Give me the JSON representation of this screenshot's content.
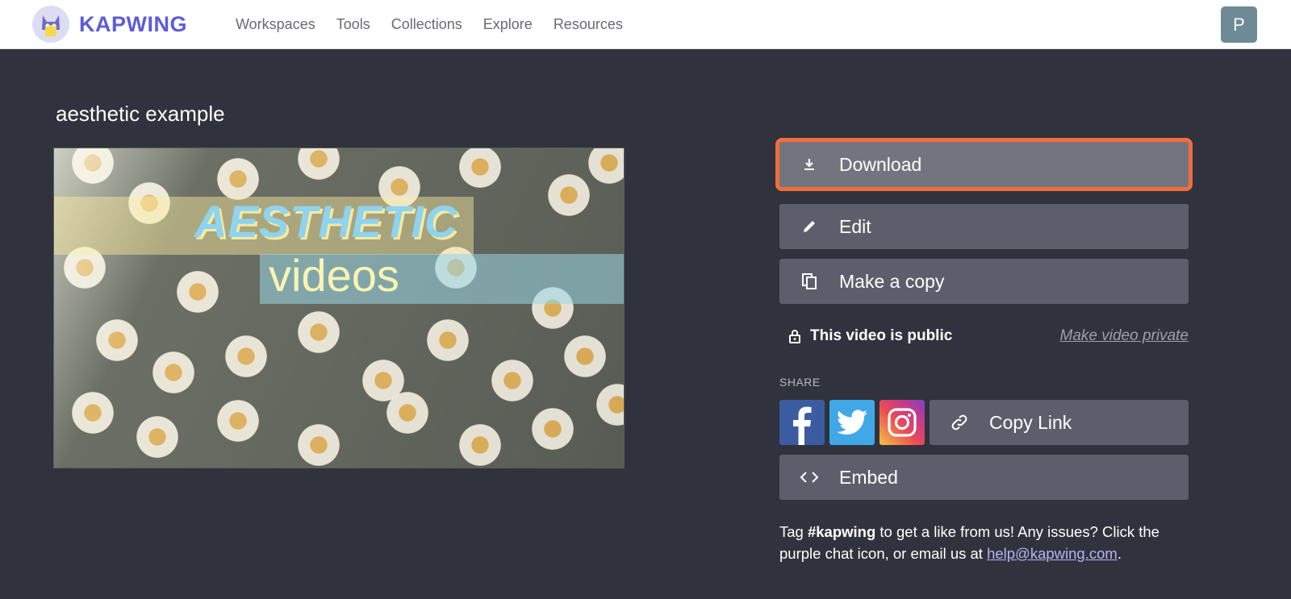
{
  "header": {
    "brand": "KAPWING",
    "nav": [
      "Workspaces",
      "Tools",
      "Collections",
      "Explore",
      "Resources"
    ],
    "avatar_initial": "P"
  },
  "project": {
    "title": "aesthetic example",
    "preview_text_line1": "AESTHETIC",
    "preview_text_line2": "videos"
  },
  "actions": {
    "download": "Download",
    "edit": "Edit",
    "copy": "Make a copy",
    "embed": "Embed"
  },
  "visibility": {
    "status": "This video is public",
    "toggle_link": "Make video private"
  },
  "share": {
    "label": "SHARE",
    "copy_link": "Copy Link"
  },
  "footer": {
    "pre": "Tag ",
    "hashtag": "#kapwing",
    "mid": " to get a like from us! Any issues? Click the purple chat icon, or email us at ",
    "email": "help@kapwing.com",
    "post": "."
  },
  "colors": {
    "brand": "#5e5cd9",
    "page_bg": "#30333d",
    "button_bg": "#5c5f6b",
    "highlight": "#f26d3b"
  },
  "icons": {
    "download": "download-icon",
    "edit": "pencil-icon",
    "copy": "copy-icon",
    "lock": "lock-icon",
    "link": "link-icon",
    "embed": "code-icon"
  }
}
